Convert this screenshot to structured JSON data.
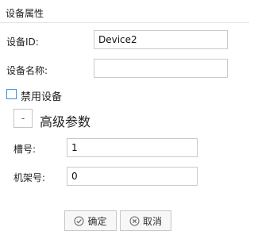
{
  "window": {
    "title": "设备属性"
  },
  "device": {
    "id_label": "设备ID:",
    "id_value": "Device2",
    "name_label": "设备名称:",
    "name_value": ""
  },
  "disable": {
    "label": "禁用设备",
    "checked": false
  },
  "advanced": {
    "toggle_symbol": "-",
    "title": "高级参数",
    "slot_label": "槽号:",
    "slot_value": "1",
    "rack_label": "机架号:",
    "rack_value": "0"
  },
  "buttons": {
    "ok": "确定",
    "cancel": "取消"
  },
  "icons": {
    "ok": "check-circle-icon",
    "cancel": "x-circle-icon"
  }
}
